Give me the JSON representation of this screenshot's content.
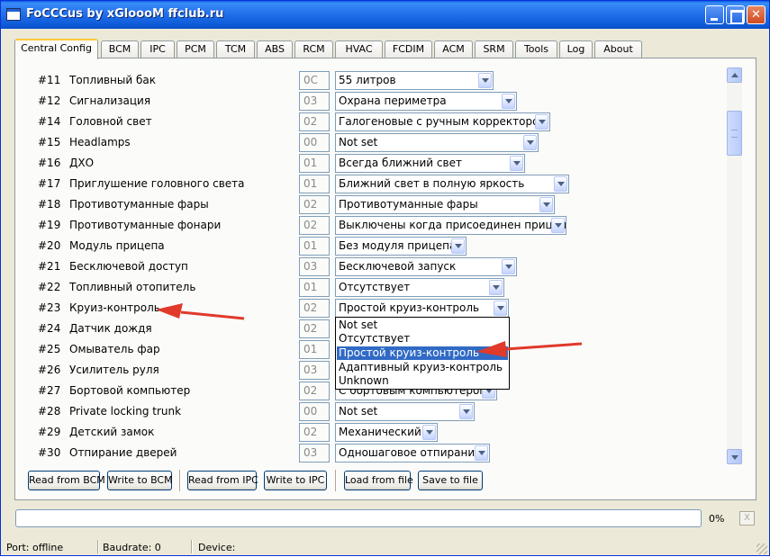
{
  "window": {
    "title": "FoCCCus by xGloooM ffclub.ru"
  },
  "tabs": [
    {
      "label": "Central Config",
      "active": true
    },
    {
      "label": "BCM"
    },
    {
      "label": "IPC"
    },
    {
      "label": "PCM"
    },
    {
      "label": "TCM"
    },
    {
      "label": "ABS"
    },
    {
      "label": "RCM"
    },
    {
      "label": "HVAC"
    },
    {
      "label": "FCDIM"
    },
    {
      "label": "ACM"
    },
    {
      "label": "SRM"
    },
    {
      "label": "Tools"
    },
    {
      "label": "Log"
    },
    {
      "label": "About"
    }
  ],
  "rows": [
    {
      "num": "#11",
      "label": "Топливный бак",
      "code": "0C",
      "value": "55 литров"
    },
    {
      "num": "#12",
      "label": "Сигнализация",
      "code": "03",
      "value": "Охрана периметра"
    },
    {
      "num": "#14",
      "label": "Головной свет",
      "code": "02",
      "value": "Галогеновые с ручным корректором"
    },
    {
      "num": "#15",
      "label": "Headlamps",
      "code": "00",
      "value": "Not set"
    },
    {
      "num": "#16",
      "label": "ДХО",
      "code": "01",
      "value": "Всегда ближний свет"
    },
    {
      "num": "#17",
      "label": "Приглушение головного света",
      "code": "01",
      "value": "Ближний свет в полную яркость"
    },
    {
      "num": "#18",
      "label": "Противотуманные фары",
      "code": "02",
      "value": "Противотуманные фары"
    },
    {
      "num": "#19",
      "label": "Противотуманные фонари",
      "code": "02",
      "value": "Выключены когда присоединен прицеп"
    },
    {
      "num": "#20",
      "label": "Модуль прицепа",
      "code": "01",
      "value": "Без модуля прицепа"
    },
    {
      "num": "#21",
      "label": "Бесключевой доступ",
      "code": "03",
      "value": "Бесключевой запуск"
    },
    {
      "num": "#22",
      "label": "Топливный отопитель",
      "code": "01",
      "value": "Отсутствует"
    },
    {
      "num": "#23",
      "label": "Круиз-контроль",
      "code": "02",
      "value": "Простой круиз-контроль"
    },
    {
      "num": "#24",
      "label": "Датчик дождя",
      "code": "02",
      "value": ""
    },
    {
      "num": "#25",
      "label": "Омыватель фар",
      "code": "01",
      "value": ""
    },
    {
      "num": "#26",
      "label": "Усилитель руля",
      "code": "03",
      "value": ""
    },
    {
      "num": "#27",
      "label": "Бортовой компьютер",
      "code": "02",
      "value": "С бортовым компьютером"
    },
    {
      "num": "#28",
      "label": "Private locking trunk",
      "code": "00",
      "value": "Not set"
    },
    {
      "num": "#29",
      "label": "Детский замок",
      "code": "02",
      "value": "Механический"
    },
    {
      "num": "#30",
      "label": "Отпирание дверей",
      "code": "03",
      "value": "Одношаговое отпирание"
    }
  ],
  "dropdown": {
    "options": [
      "Not set",
      "Отсутствует",
      "Простой круиз-контроль",
      "Адаптивный круиз-контроль",
      "Unknown"
    ],
    "selected_index": 2
  },
  "buttons": {
    "read_bcm": "Read from BCM",
    "write_bcm": "Write to BCM",
    "read_ipc": "Read from IPC",
    "write_ipc": "Write to IPC",
    "load_file": "Load from file",
    "save_file": "Save to file"
  },
  "progress": {
    "value": 0,
    "text": "0%",
    "cancel": "X"
  },
  "status": {
    "port": "Port: offline",
    "baudrate": "Baudrate: 0",
    "device": "Device:"
  },
  "colors": {
    "annotation_arrow": "#e03a2a",
    "selection": "#316ac5",
    "titlebar": "#0a5fe8"
  }
}
